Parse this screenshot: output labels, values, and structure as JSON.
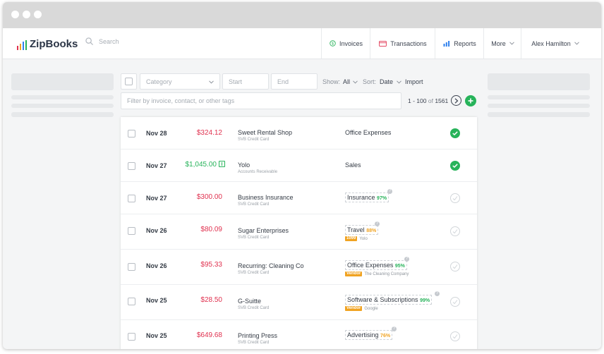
{
  "app": {
    "logo_text": "ZipBooks",
    "logo_colors": [
      "#e0314f",
      "#f0a322",
      "#2f80ed",
      "#27b35a"
    ]
  },
  "search": {
    "placeholder": "Search"
  },
  "nav": {
    "invoices": "Invoices",
    "transactions": "Transactions",
    "reports": "Reports",
    "more": "More",
    "user": "Alex Hamilton"
  },
  "toolbar": {
    "category_placeholder": "Category",
    "start_placeholder": "Start",
    "end_placeholder": "End",
    "show_label": "Show:",
    "show_value": "All",
    "sort_label": "Sort:",
    "sort_value": "Date",
    "import_label": "Import",
    "filter_placeholder": "Filter by invoice, contact, or other tags",
    "pagination_range": "1 - 100",
    "pagination_of": "of",
    "pagination_total": "1561"
  },
  "colors": {
    "negative": "#e0314f",
    "positive": "#27b35a",
    "tag": "#f0a322",
    "accent": "#27b35a"
  },
  "transactions": [
    {
      "date": "Nov 28",
      "amount": "$324.12",
      "type": "negative",
      "payee": "Sweet Rental Shop",
      "account": "SVB Credit Card",
      "category": "Office Expenses",
      "confidence": "",
      "tag": "",
      "tag_value": "",
      "status": "done"
    },
    {
      "date": "Nov 27",
      "amount": "$1,045.00",
      "type": "positive",
      "payee": "Yolo",
      "account": "Accounts Receivable",
      "category": "Sales",
      "confidence": "",
      "tag": "",
      "tag_value": "",
      "status": "done",
      "invoice_icon": "invoice-icon"
    },
    {
      "date": "Nov 27",
      "amount": "$300.00",
      "type": "negative",
      "payee": "Business Insurance",
      "account": "SVB Credit Card",
      "category": "Insurance",
      "confidence": "97%",
      "confidence_color": "#27b35a",
      "tag": "",
      "tag_value": "",
      "status": "pending"
    },
    {
      "date": "Nov 26",
      "amount": "$80.09",
      "type": "negative",
      "payee": "Sugar Enterprises",
      "account": "SVB Credit Card",
      "category": "Travel",
      "confidence": "88%",
      "confidence_color": "#f0a322",
      "tag": "1099",
      "tag_value": "Yolo",
      "status": "pending"
    },
    {
      "date": "Nov 26",
      "amount": "$95.33",
      "type": "negative",
      "payee": "Recurring: Cleaning Co",
      "account": "SVB Credit Card",
      "category": "Office Expenses",
      "confidence": "95%",
      "confidence_color": "#27b35a",
      "tag": "Vendor",
      "tag_value": "The Cleaning Company",
      "status": "pending"
    },
    {
      "date": "Nov 25",
      "amount": "$28.50",
      "type": "negative",
      "payee": "G-Suitte",
      "account": "SVB Credit Card",
      "category": "Software & Subscriptions",
      "confidence": "99%",
      "confidence_color": "#27b35a",
      "tag": "Vendor",
      "tag_value": "Google",
      "status": "pending"
    },
    {
      "date": "Nov 25",
      "amount": "$649.68",
      "type": "negative",
      "payee": "Printing Press",
      "account": "SVB Credit Card",
      "category": "Advertising",
      "confidence": "76%",
      "confidence_color": "#f0a322",
      "tag": "",
      "tag_value": "",
      "status": "pending"
    }
  ]
}
